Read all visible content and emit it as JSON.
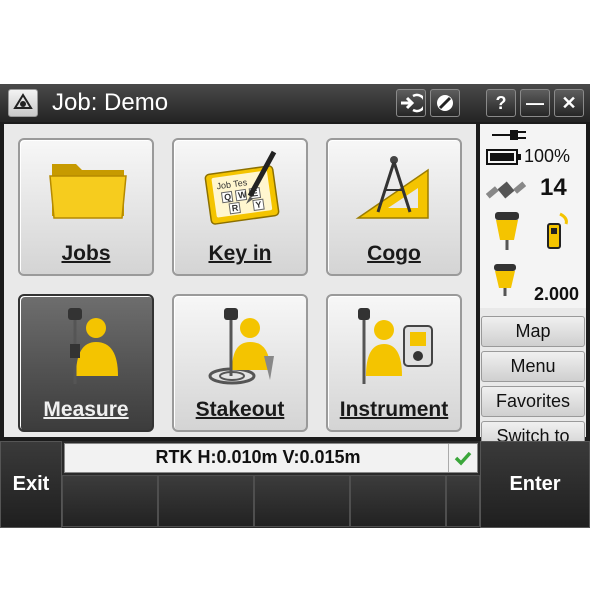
{
  "titlebar": {
    "title": "Job: Demo",
    "help": "?",
    "minimize": "—",
    "close": "✕"
  },
  "tiles": [
    {
      "label": "Jobs",
      "icon": "folder-icon"
    },
    {
      "label": "Key in",
      "icon": "keyin-icon"
    },
    {
      "label": "Cogo",
      "icon": "cogo-icon"
    },
    {
      "label": "Measure",
      "icon": "measure-icon",
      "selected": true
    },
    {
      "label": "Stakeout",
      "icon": "stakeout-icon"
    },
    {
      "label": "Instrument",
      "icon": "instrument-icon"
    }
  ],
  "keyin_card": {
    "line1": "Job Tes",
    "keys": [
      "Q",
      "W",
      "E",
      "R",
      "Y"
    ]
  },
  "status": {
    "battery": "100%",
    "satellites": "14",
    "height": "2.000"
  },
  "side_buttons": [
    "Map",
    "Menu",
    "Favorites",
    "Switch to"
  ],
  "bottom": {
    "exit": "Exit",
    "enter": "Enter",
    "rtk": "RTK H:0.010m V:0.015m"
  },
  "colors": {
    "accent_yellow": "#f4c400",
    "check_green": "#3aa63a"
  }
}
